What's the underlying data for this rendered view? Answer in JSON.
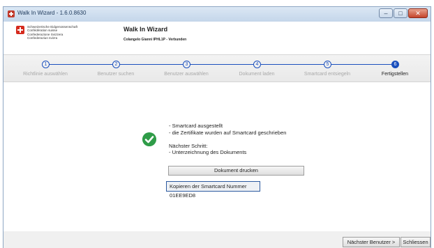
{
  "window": {
    "title": "Walk In Wizard - 1.6.0.8630",
    "minimize_glyph": "–",
    "maximize_glyph": "□",
    "close_glyph": "✕"
  },
  "header": {
    "confederation_lines": [
      "Schweizerische Eidgenossenschaft",
      "Confédération suisse",
      "Confederazione Svizzera",
      "Confederaziun svizra"
    ],
    "wizard_title": "Walk In Wizard",
    "wizard_subtitle": "Colangelo Gianni IPHL1P - Verbunden"
  },
  "steps": [
    {
      "number": "1",
      "label": "Richtlinie auswählen",
      "active": false
    },
    {
      "number": "2",
      "label": "Benutzer suchen",
      "active": false
    },
    {
      "number": "3",
      "label": "Benutzer auswählen",
      "active": false
    },
    {
      "number": "4",
      "label": "Dokument laden",
      "active": false
    },
    {
      "number": "5",
      "label": "Smartcard entsiegeln",
      "active": false
    },
    {
      "number": "6",
      "label": "Fertigstellen",
      "active": true
    }
  ],
  "content": {
    "status_icon": "check-icon",
    "message_lines": [
      "- Smartcard ausgestellt",
      "- die Zertifikate wurden auf Smartcard geschrieben",
      "",
      "Nächster Schritt:",
      "- Unterzeichnung des Dokuments"
    ],
    "print_button": "Dokument drucken",
    "copy_button": "Kopieren der Smartcard Nummer 01EE9ED8"
  },
  "footer": {
    "next_user_button": "Nächster Benutzer >",
    "close_button": "Schliessen"
  },
  "colors": {
    "accent": "#1a4fbd",
    "success": "#2f9c48",
    "swiss_red": "#d52b1e"
  }
}
